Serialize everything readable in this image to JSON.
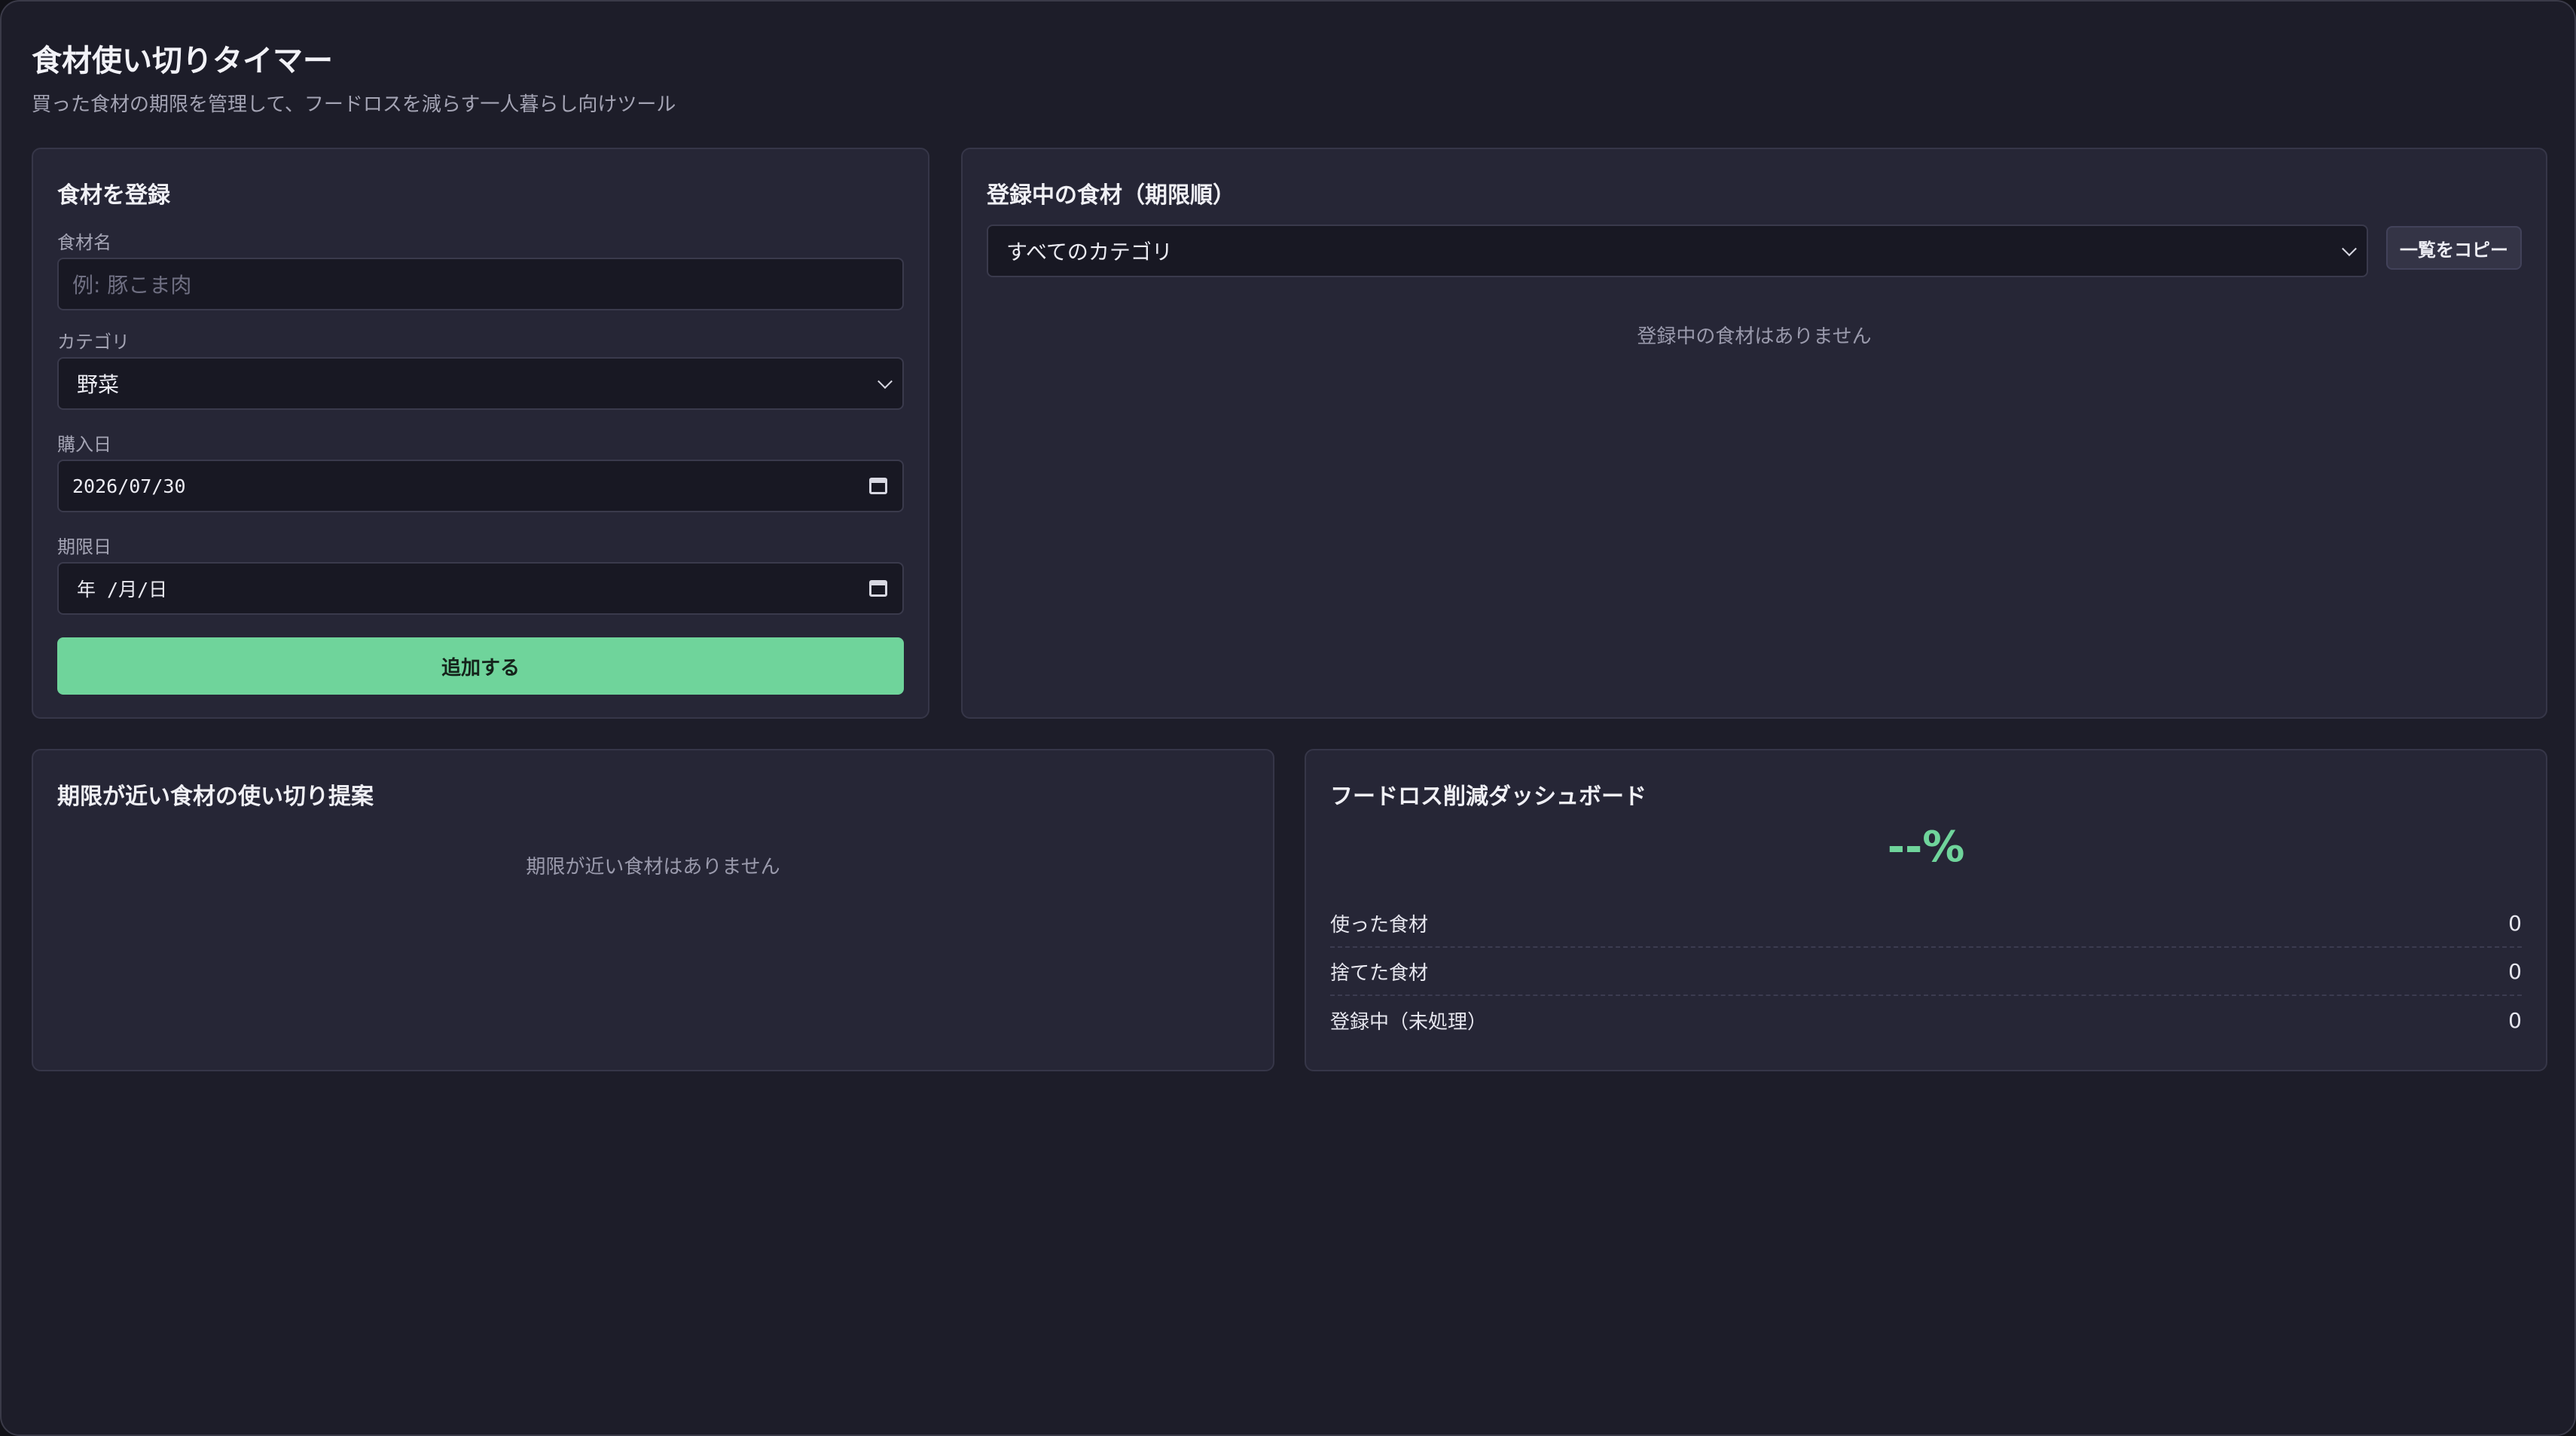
{
  "header": {
    "title": "食材使い切りタイマー",
    "subtitle": "買った食材の期限を管理して、フードロスを減らす一人暮らし向けツール"
  },
  "register_panel": {
    "title": "食材を登録",
    "name_label": "食材名",
    "name_placeholder": "例: 豚こま肉",
    "name_value": "",
    "category_label": "カテゴリ",
    "category_value": "野菜",
    "purchase_label": "購入日",
    "purchase_value": "2026/07/30",
    "expiry_label": "期限日",
    "expiry_value": "年 /月/日",
    "add_button": "追加する",
    "icons": {
      "select": "chevron-down-icon",
      "date": "calendar-icon"
    }
  },
  "list_panel": {
    "title": "登録中の食材（期限順）",
    "filter_value": "すべてのカテゴリ",
    "copy_button": "一覧をコピー",
    "empty_message": "登録中の食材はありません"
  },
  "suggest_panel": {
    "title": "期限が近い食材の使い切り提案",
    "empty_message": "期限が近い食材はありません"
  },
  "dashboard_panel": {
    "title": "フードロス削減ダッシュボード",
    "rate": "--%",
    "stats": [
      {
        "label": "使った食材",
        "value": "0"
      },
      {
        "label": "捨てた食材",
        "value": "0"
      },
      {
        "label": "登録中（未処理）",
        "value": "0"
      }
    ]
  },
  "colors": {
    "accent": "#6fd49b",
    "background": "#1d1d29",
    "panel": "#262636"
  }
}
